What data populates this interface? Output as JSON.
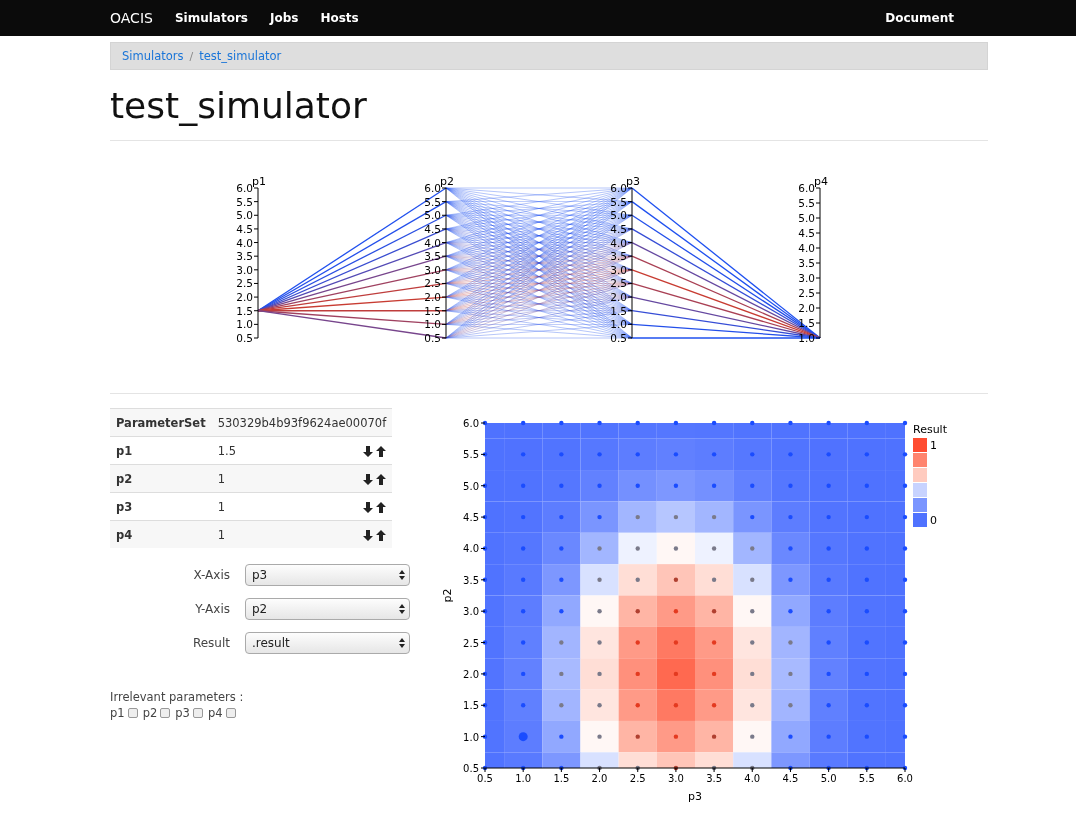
{
  "navbar": {
    "brand": "OACIS",
    "links": [
      "Simulators",
      "Jobs",
      "Hosts"
    ],
    "right_link": "Document"
  },
  "breadcrumb": {
    "items": [
      "Simulators",
      "test_simulator"
    ],
    "separator": "/"
  },
  "title": "test_simulator",
  "parallel_coordinates": {
    "axes": [
      {
        "name": "p1",
        "ticks": [
          "6.0",
          "5.5",
          "5.0",
          "4.5",
          "4.0",
          "3.5",
          "3.0",
          "2.5",
          "2.0",
          "1.5",
          "1.0",
          "0.5"
        ]
      },
      {
        "name": "p2",
        "ticks": [
          "6.0",
          "5.5",
          "5.0",
          "4.5",
          "4.0",
          "3.5",
          "3.0",
          "2.5",
          "2.0",
          "1.5",
          "1.0",
          "0.5"
        ]
      },
      {
        "name": "p3",
        "ticks": [
          "6.0",
          "5.5",
          "5.0",
          "4.5",
          "4.0",
          "3.5",
          "3.0",
          "2.5",
          "2.0",
          "1.5",
          "1.0",
          "0.5"
        ]
      },
      {
        "name": "p4",
        "ticks": [
          "6.0",
          "5.5",
          "5.0",
          "4.5",
          "4.0",
          "3.5",
          "3.0",
          "2.5",
          "2.0",
          "1.5",
          "1.0"
        ]
      }
    ]
  },
  "parameter_table": {
    "header": {
      "label": "ParameterSet",
      "value": "530329b4b93f9624ae00070f"
    },
    "rows": [
      {
        "name": "p1",
        "value": "1.5"
      },
      {
        "name": "p2",
        "value": "1"
      },
      {
        "name": "p3",
        "value": "1"
      },
      {
        "name": "p4",
        "value": "1"
      }
    ]
  },
  "controls": [
    {
      "label": "X-Axis",
      "value": "p3"
    },
    {
      "label": "Y-Axis",
      "value": "p2"
    },
    {
      "label": "Result",
      "value": ".result"
    }
  ],
  "irrelevant": {
    "label": "Irrelevant parameters :",
    "params": [
      {
        "name": "p1",
        "checked": false
      },
      {
        "name": "p2",
        "checked": false
      },
      {
        "name": "p3",
        "checked": false
      },
      {
        "name": "p4",
        "checked": false
      }
    ]
  },
  "heatmap": {
    "x_axis": {
      "title": "p3",
      "ticks": [
        "0.5",
        "1.0",
        "1.5",
        "2.0",
        "2.5",
        "3.0",
        "3.5",
        "4.0",
        "4.5",
        "5.0",
        "5.5",
        "6.0"
      ]
    },
    "y_axis": {
      "title": "p2",
      "ticks": [
        "6.0",
        "5.5",
        "5.0",
        "4.5",
        "4.0",
        "3.5",
        "3.0",
        "2.5",
        "2.0",
        "1.5",
        "1.0",
        "0.5"
      ]
    },
    "legend": {
      "title": "Result",
      "max": "1",
      "min": "0"
    }
  }
}
